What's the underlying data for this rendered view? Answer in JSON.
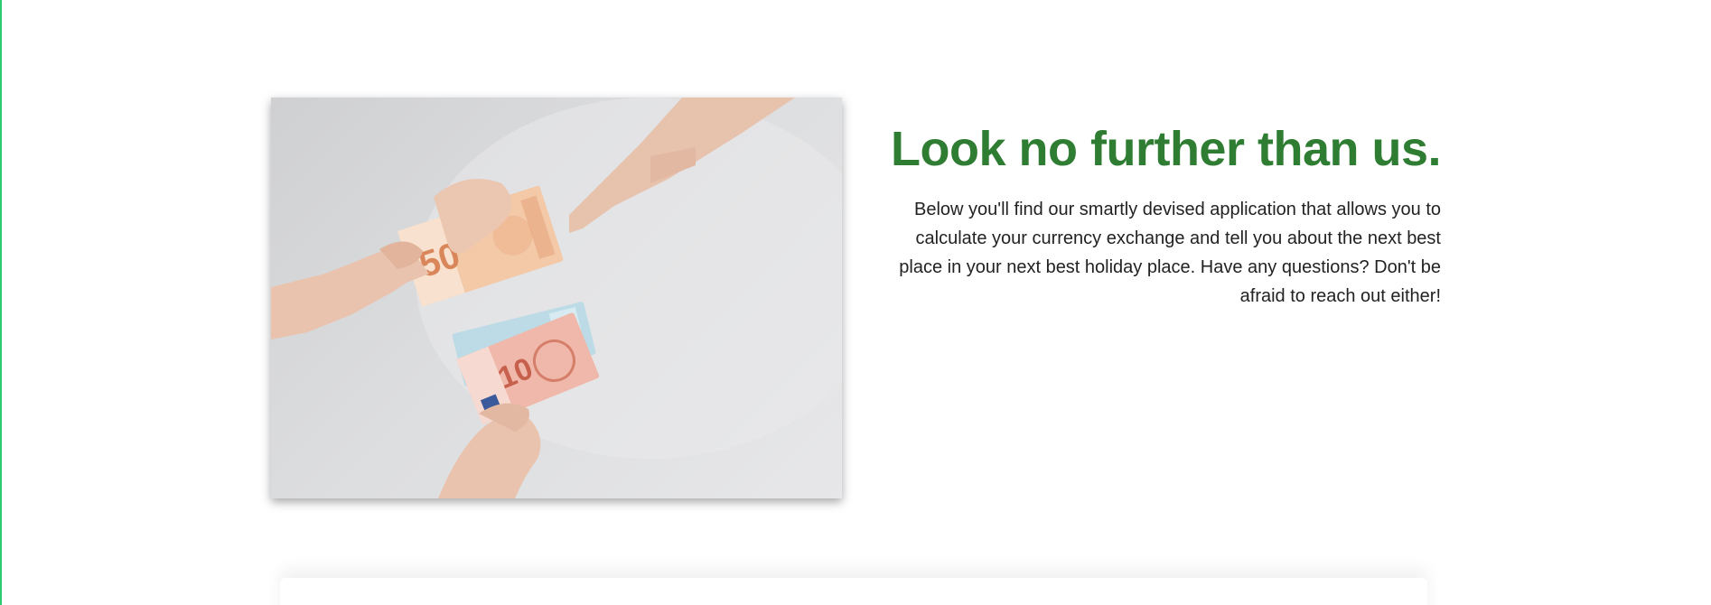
{
  "hero": {
    "image_alt": "Hands exchanging euro banknotes",
    "headline": "Look no further than us.",
    "description": "Below you'll find our smartly devised application that allows you to calculate your currency exchange and tell you about the next best place in your next best holiday place. Have any questions? Don't be afraid to reach out either!"
  },
  "colors": {
    "accent": "#2e7d32",
    "left_edge": "#2ecc71",
    "body_text": "#222222"
  }
}
